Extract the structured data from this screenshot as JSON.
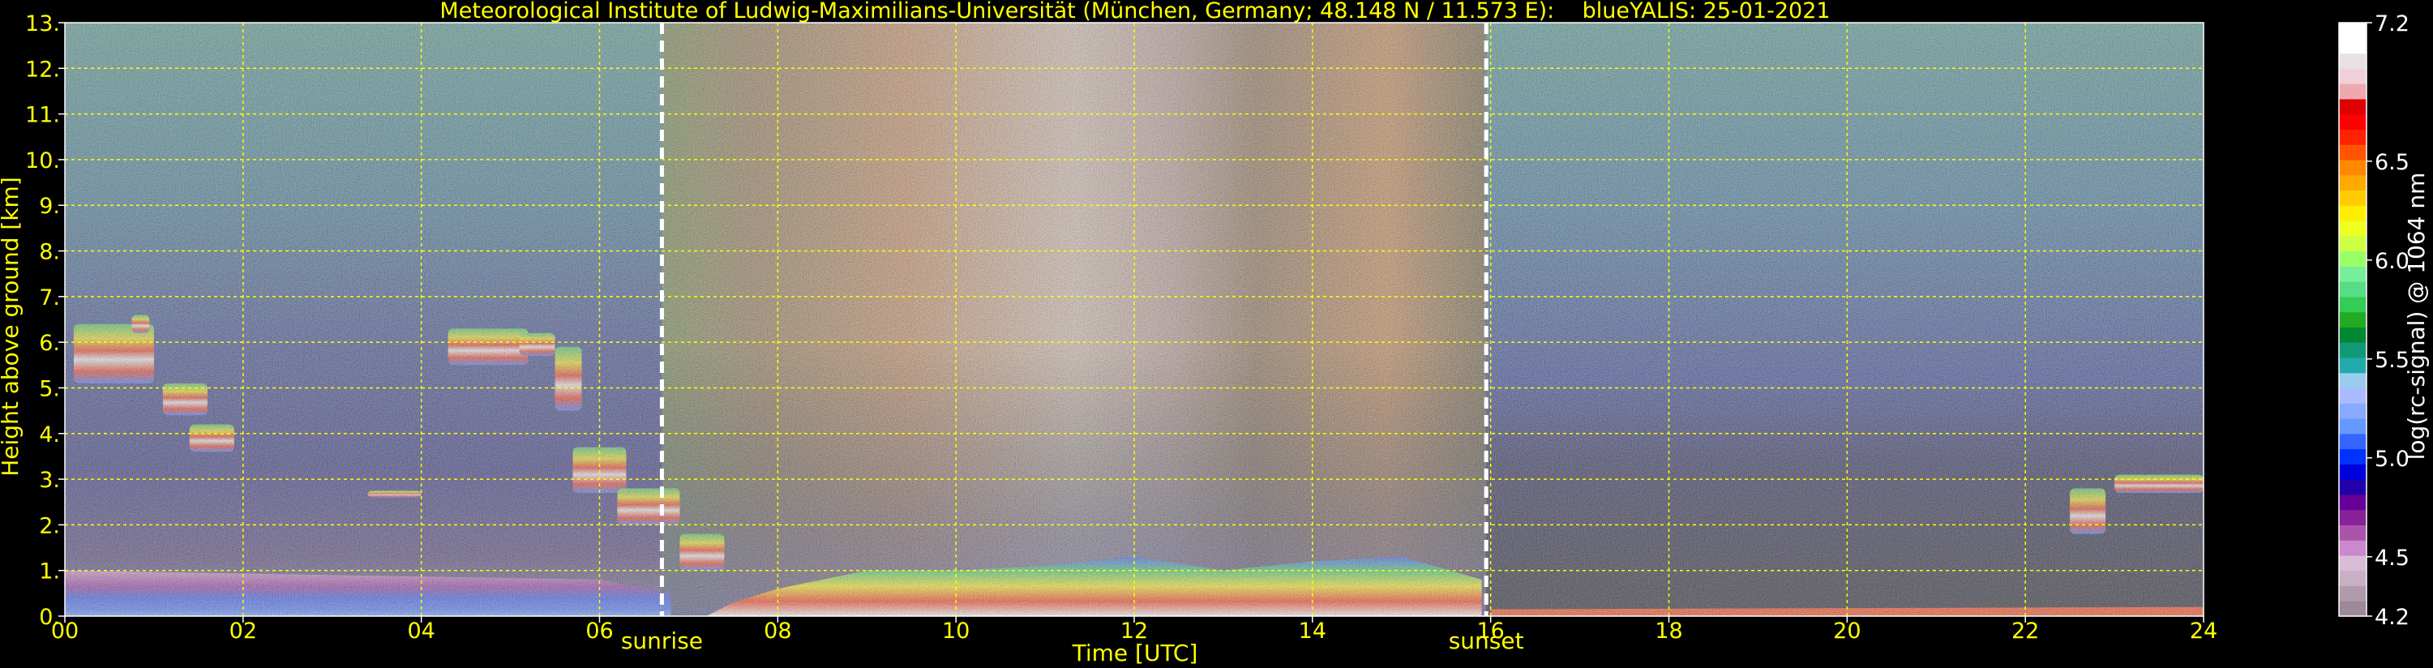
{
  "chart_data": {
    "type": "heatmap",
    "title": "Meteorological Institute of Ludwig-Maximilians-Universität (München, Germany; 48.148 N / 11.573 E):    blueYALIS: 25-01-2021",
    "xlabel": "Time [UTC]",
    "ylabel": "Height above ground [km]",
    "xlim": [
      0,
      24
    ],
    "ylim": [
      0,
      13
    ],
    "x_ticks": [
      "00",
      "02",
      "04",
      "06",
      "08",
      "10",
      "12",
      "14",
      "16",
      "18",
      "20",
      "22",
      "24"
    ],
    "x_tick_values": [
      0,
      2,
      4,
      6,
      8,
      10,
      12,
      14,
      16,
      18,
      20,
      22,
      24
    ],
    "y_ticks": [
      "0.",
      "1.",
      "2.",
      "3.",
      "4.",
      "5.",
      "6.",
      "7.",
      "8.",
      "9.",
      "10.",
      "11.",
      "12.",
      "13."
    ],
    "y_tick_values": [
      0,
      1,
      2,
      3,
      4,
      5,
      6,
      7,
      8,
      9,
      10,
      11,
      12,
      13
    ],
    "grid": true,
    "annotations": [
      {
        "text": "sunrise",
        "x": 6.7
      },
      {
        "text": "sunset",
        "x": 15.95
      }
    ],
    "colorbar": {
      "label": "log(rc-signal) @ 1064 nm",
      "range": [
        4.2,
        7.2
      ],
      "tick_labels": [
        "4.2",
        "4.5",
        "5.0",
        "5.5",
        "6.0",
        "6.5",
        "7.2"
      ],
      "tick_values": [
        4.2,
        4.5,
        5.0,
        5.5,
        6.0,
        6.5,
        7.2
      ],
      "colors": [
        "#9c8a98",
        "#b09aac",
        "#c8b0c4",
        "#d8bcd8",
        "#cc88cc",
        "#aa55aa",
        "#882299",
        "#660099",
        "#2200aa",
        "#0000dd",
        "#0033ff",
        "#3366ff",
        "#6699ff",
        "#88aaff",
        "#aabbff",
        "#99ccee",
        "#22aaaa",
        "#119977",
        "#008833",
        "#22aa22",
        "#33cc55",
        "#55dd88",
        "#77ee99",
        "#99ff66",
        "#ccff44",
        "#eeff22",
        "#ffee00",
        "#ffcc00",
        "#ffaa00",
        "#ff8800",
        "#ff5500",
        "#ff2200",
        "#ff0000",
        "#dd0000",
        "#f0a8b0",
        "#f0d0d8",
        "#e8e0e4",
        "#ffffff",
        "#ffffff"
      ]
    },
    "fields": {
      "clouds": [
        {
          "x": 0.1,
          "y": 5.1,
          "w": 0.9,
          "h": 1.3
        },
        {
          "x": 0.75,
          "y": 6.2,
          "w": 0.2,
          "h": 0.4
        },
        {
          "x": 1.1,
          "y": 4.4,
          "w": 0.5,
          "h": 0.7
        },
        {
          "x": 1.4,
          "y": 3.6,
          "w": 0.5,
          "h": 0.6
        },
        {
          "x": 3.4,
          "y": 2.6,
          "w": 0.6,
          "h": 0.15
        },
        {
          "x": 4.3,
          "y": 5.5,
          "w": 0.9,
          "h": 0.8
        },
        {
          "x": 5.1,
          "y": 5.7,
          "w": 0.4,
          "h": 0.5
        },
        {
          "x": 5.5,
          "y": 4.5,
          "w": 0.3,
          "h": 1.4
        },
        {
          "x": 5.7,
          "y": 2.7,
          "w": 0.6,
          "h": 1.0
        },
        {
          "x": 6.2,
          "y": 2.0,
          "w": 0.7,
          "h": 0.8
        },
        {
          "x": 6.9,
          "y": 1.0,
          "w": 0.5,
          "h": 0.8
        },
        {
          "x": 23.0,
          "y": 2.7,
          "w": 1.0,
          "h": 0.4
        },
        {
          "x": 22.5,
          "y": 1.8,
          "w": 0.4,
          "h": 1.0
        }
      ]
    }
  }
}
